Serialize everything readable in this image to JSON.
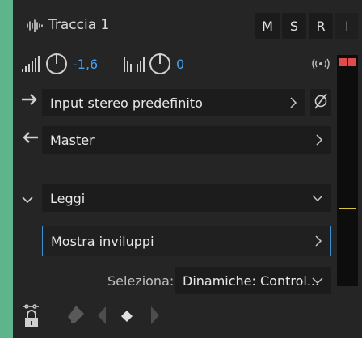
{
  "track": {
    "title": "Traccia 1",
    "buttons": [
      "M",
      "S",
      "R",
      "I"
    ],
    "volume_value": "-1,6",
    "pan_value": "0"
  },
  "routing": {
    "input_label": "Input stereo predefinito",
    "output_label": "Master"
  },
  "automation": {
    "mode_label": "Leggi",
    "envelopes_label": "Mostra inviluppi",
    "select_label": "Seleziona:",
    "select_value": "Dinamiche: Control..."
  },
  "icons": {
    "track_icon": "waveform-icon",
    "volume_icon": "volume-ramp-icon",
    "pan_icon": "pan-icon",
    "input_icon": "arrow-right-icon",
    "output_icon": "arrow-left-icon",
    "phase_icon": "phase-invert-icon",
    "monitor_icon": "input-monitor-icon",
    "collapse_icon": "chevron-down-icon",
    "lock_icon": "lock-icon",
    "eraser_icon": "eraser-icon",
    "prev_icon": "previous-keyframe-icon",
    "add_icon": "add-keyframe-icon",
    "next_icon": "next-keyframe-icon"
  },
  "colors": {
    "track_color": "#5fb58b",
    "value_blue": "#44a3f5",
    "meter_red": "#e34b4b",
    "meter_yellow": "#d8c43a",
    "focus_blue": "#3d8fd8"
  }
}
